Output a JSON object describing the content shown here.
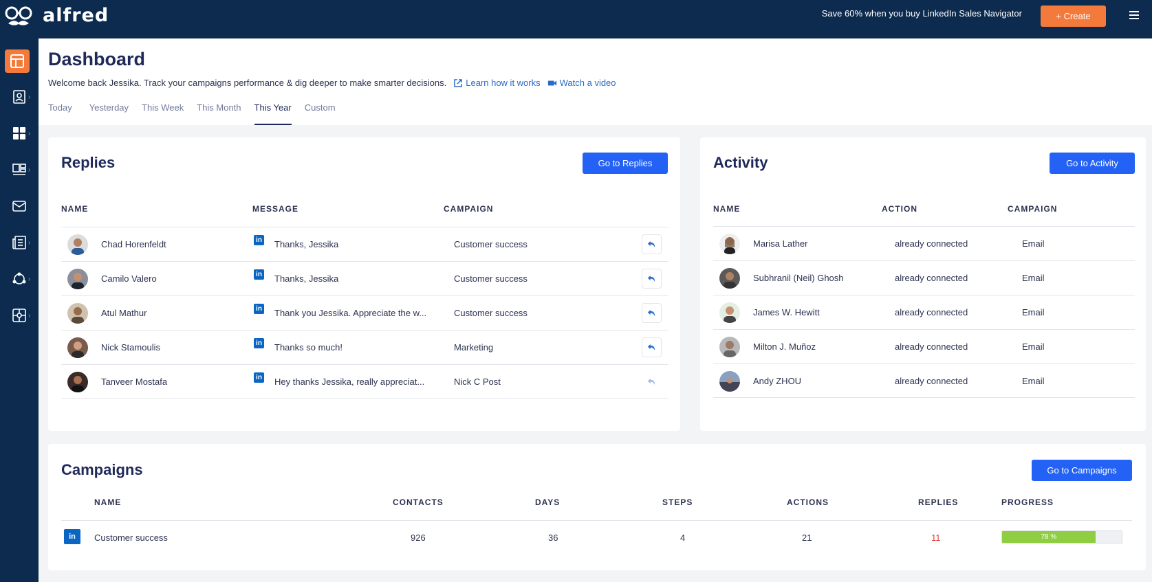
{
  "app": {
    "name": "alfred",
    "promo_text": "Save 60% when you buy LinkedIn Sales Navigator",
    "create_label": "+ Create"
  },
  "colors": {
    "navy": "#0c2b4e",
    "accent_orange": "#f47a3c",
    "primary_blue": "#2462f5",
    "progress_green": "#8fce42",
    "replies_red": "#e0453a"
  },
  "sidebar": {
    "items": [
      {
        "icon": "dashboard-icon",
        "active": true
      },
      {
        "icon": "contacts-icon",
        "active": false
      },
      {
        "icon": "apps-grid-icon",
        "active": false
      },
      {
        "icon": "templates-icon",
        "active": false
      },
      {
        "icon": "mail-icon",
        "active": false
      },
      {
        "icon": "reports-icon",
        "active": false
      },
      {
        "icon": "network-icon",
        "active": false
      },
      {
        "icon": "integrations-icon",
        "active": false
      }
    ]
  },
  "header": {
    "title": "Dashboard",
    "welcome": "Welcome back Jessika. Track your campaigns performance & dig deeper to make smarter decisions.",
    "learn_link": "Learn how it works",
    "video_link": "Watch a video",
    "tabs": [
      "Today",
      "Yesterday",
      "This Week",
      "This Month",
      "This Year",
      "Custom"
    ],
    "active_tab": "This Year"
  },
  "replies": {
    "title": "Replies",
    "button": "Go to Replies",
    "columns": [
      "NAME",
      "MESSAGE",
      "CAMPAIGN"
    ],
    "rows": [
      {
        "name": "Chad Horenfeldt",
        "message": "Thanks, Jessika",
        "campaign": "Customer success"
      },
      {
        "name": "Camilo Valero",
        "message": "Thanks, Jessika",
        "campaign": "Customer success"
      },
      {
        "name": "Atul Mathur",
        "message": "Thank you Jessika. Appreciate the w...",
        "campaign": "Customer success"
      },
      {
        "name": "Nick Stamoulis",
        "message": "Thanks so much!",
        "campaign": "Marketing"
      },
      {
        "name": "Tanveer Mostafa",
        "message": "Hey thanks Jessika, really appreciat...",
        "campaign": "Nick C Post"
      }
    ]
  },
  "activity": {
    "title": "Activity",
    "button": "Go to Activity",
    "columns": [
      "NAME",
      "ACTION",
      "CAMPAIGN"
    ],
    "rows": [
      {
        "name": "Marisa Lather",
        "action": "already connected",
        "campaign": "Email"
      },
      {
        "name": "Subhranil (Neil) Ghosh",
        "action": "already connected",
        "campaign": "Email"
      },
      {
        "name": "James W. Hewitt",
        "action": "already connected",
        "campaign": "Email"
      },
      {
        "name": "Milton J. Muñoz",
        "action": "already connected",
        "campaign": "Email"
      },
      {
        "name": "Andy ZHOU",
        "action": "already connected",
        "campaign": "Email"
      }
    ]
  },
  "campaigns": {
    "title": "Campaigns",
    "button": "Go to Campaigns",
    "columns": [
      "NAME",
      "CONTACTS",
      "DAYS",
      "STEPS",
      "ACTIONS",
      "REPLIES",
      "PROGRESS"
    ],
    "rows": [
      {
        "name": "Customer success",
        "contacts": "926",
        "days": "36",
        "steps": "4",
        "actions": "21",
        "replies": "11",
        "progress_label": "78 %",
        "progress": 0.78
      }
    ]
  }
}
